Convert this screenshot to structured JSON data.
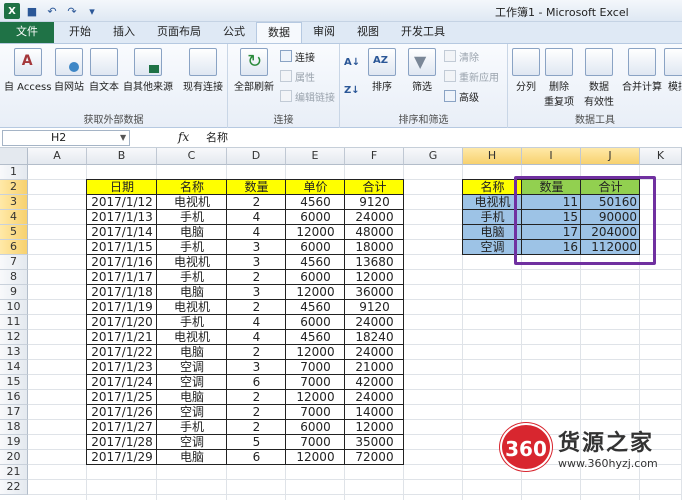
{
  "window": {
    "title": "工作簿1 - Microsoft Excel"
  },
  "tabs": [
    "文件",
    "开始",
    "插入",
    "页面布局",
    "公式",
    "数据",
    "审阅",
    "视图",
    "开发工具"
  ],
  "active_tab": "数据",
  "ribbon": {
    "group_external": {
      "label": "获取外部数据",
      "access": "自 Access",
      "web": "自网站",
      "text": "自文本",
      "other": "自其他来源",
      "existing": "现有连接"
    },
    "group_connections": {
      "label": "连接",
      "refresh_all": "全部刷新",
      "connections": "连接",
      "properties": "属性",
      "edit_links": "编辑链接"
    },
    "group_sort_filter": {
      "label": "排序和筛选",
      "sort": "排序",
      "filter": "筛选",
      "clear": "清除",
      "reapply": "重新应用",
      "advanced": "高级"
    },
    "group_data_tools": {
      "label": "数据工具",
      "split": "分列",
      "remove_dup_line1": "删除",
      "remove_dup_line2": "重复项",
      "validation_line1": "数据",
      "validation_line2": "有效性",
      "consolidate": "合并计算",
      "whatif": "模拟"
    }
  },
  "formula_bar": {
    "name_box": "H2",
    "fx": "fx",
    "formula": "名称"
  },
  "columns": [
    "A",
    "B",
    "C",
    "D",
    "E",
    "F",
    "G",
    "H",
    "I",
    "J",
    "K"
  ],
  "rows": [
    "1",
    "2",
    "3",
    "4",
    "5",
    "6",
    "7",
    "8",
    "9",
    "10",
    "11",
    "12",
    "13",
    "14",
    "15",
    "16",
    "17",
    "18",
    "19",
    "20",
    "21",
    "22"
  ],
  "main_table": {
    "headers": [
      "日期",
      "名称",
      "数量",
      "单价",
      "合计"
    ],
    "rows": [
      [
        "2017/1/12",
        "电视机",
        "2",
        "4560",
        "9120"
      ],
      [
        "2017/1/13",
        "手机",
        "4",
        "6000",
        "24000"
      ],
      [
        "2017/1/14",
        "电脑",
        "4",
        "12000",
        "48000"
      ],
      [
        "2017/1/15",
        "手机",
        "3",
        "6000",
        "18000"
      ],
      [
        "2017/1/16",
        "电视机",
        "3",
        "4560",
        "13680"
      ],
      [
        "2017/1/17",
        "手机",
        "2",
        "6000",
        "12000"
      ],
      [
        "2017/1/18",
        "电脑",
        "3",
        "12000",
        "36000"
      ],
      [
        "2017/1/19",
        "电视机",
        "2",
        "4560",
        "9120"
      ],
      [
        "2017/1/20",
        "手机",
        "4",
        "6000",
        "24000"
      ],
      [
        "2017/1/21",
        "电视机",
        "4",
        "4560",
        "18240"
      ],
      [
        "2017/1/22",
        "电脑",
        "2",
        "12000",
        "24000"
      ],
      [
        "2017/1/23",
        "空调",
        "3",
        "7000",
        "21000"
      ],
      [
        "2017/1/24",
        "空调",
        "6",
        "7000",
        "42000"
      ],
      [
        "2017/1/25",
        "电脑",
        "2",
        "12000",
        "24000"
      ],
      [
        "2017/1/26",
        "空调",
        "2",
        "7000",
        "14000"
      ],
      [
        "2017/1/27",
        "手机",
        "2",
        "6000",
        "12000"
      ],
      [
        "2017/1/28",
        "空调",
        "5",
        "7000",
        "35000"
      ],
      [
        "2017/1/29",
        "电脑",
        "6",
        "12000",
        "72000"
      ]
    ]
  },
  "summary_table": {
    "headers": [
      "名称",
      "数量",
      "合计"
    ],
    "rows": [
      [
        "电视机",
        "11",
        "50160"
      ],
      [
        "手机",
        "15",
        "90000"
      ],
      [
        "电脑",
        "17",
        "204000"
      ],
      [
        "空调",
        "16",
        "112000"
      ]
    ]
  },
  "watermark": {
    "logo": "360",
    "name": "货源之家",
    "url": "www.360hyzj.com"
  },
  "colors": {
    "header_yellow": "#ffff00",
    "header_green": "#92d050",
    "summary_blue": "#9dc3e6",
    "highlight_purple": "#7030a0",
    "file_tab": "#1f7246"
  }
}
